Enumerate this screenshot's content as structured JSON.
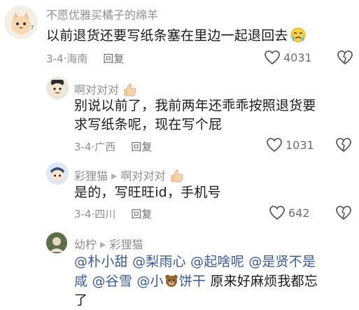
{
  "comments": [
    {
      "username": "不愿优雅买橘子的绵羊",
      "text": "以前退货还要写纸条塞在里边一起退回去",
      "emoji": "crying-face-icon",
      "date": "3-4",
      "location": "海南",
      "reply_label": "回复",
      "likes": "4031"
    },
    {
      "username": "啊对对对",
      "badge": "thumbs-up-icon",
      "text_line1": "别说以前了，我前两年还乖乖按照退货要",
      "text_line2": "求写纸条呢，现在写个屁",
      "date": "3-4",
      "location": "广西",
      "reply_label": "回复",
      "likes": "1031"
    },
    {
      "username": "彩狸猫",
      "reply_to": "啊对对对",
      "badge": "thumbs-up-icon",
      "text": "是的，写旺旺id，手机号",
      "date": "3-4",
      "location": "四川",
      "reply_label": "回复",
      "likes": "642"
    },
    {
      "username": "幼柠",
      "reply_to": "彩狸猫",
      "mentions_line1": [
        "@朴小甜",
        "@梨雨心",
        "@起啥呢",
        "@是贤不是"
      ],
      "line2_mention_a": "咸",
      "line2_mention_b": "@谷雪",
      "line2_mention_c": "@小",
      "line2_mention_d": "饼干",
      "line2_text": "原来好麻烦我都忘",
      "line3_text": "了",
      "bear_emoji": "bear-face-icon"
    }
  ],
  "separator": "·",
  "colors": {
    "mention": "#3c5a9a",
    "meta": "#8e8e93",
    "text": "#1a1a1a"
  }
}
